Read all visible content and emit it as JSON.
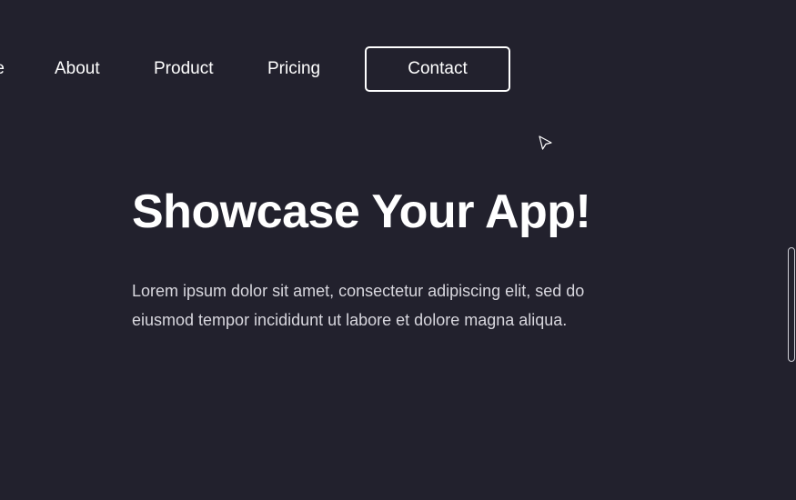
{
  "nav": {
    "home_fragment": "e",
    "about": "About",
    "product": "Product",
    "pricing": "Pricing",
    "contact": "Contact"
  },
  "hero": {
    "title": "Showcase Your App!",
    "body": "Lorem ipsum dolor sit amet, consectetur adipiscing elit, sed do eiusmod tempor incididunt ut labore et dolore magna aliqua."
  },
  "colors": {
    "background": "#22212d",
    "text_primary": "#ffffff",
    "text_body": "#d8d7de"
  },
  "icons": {
    "cursor": "mouse-pointer-icon"
  }
}
